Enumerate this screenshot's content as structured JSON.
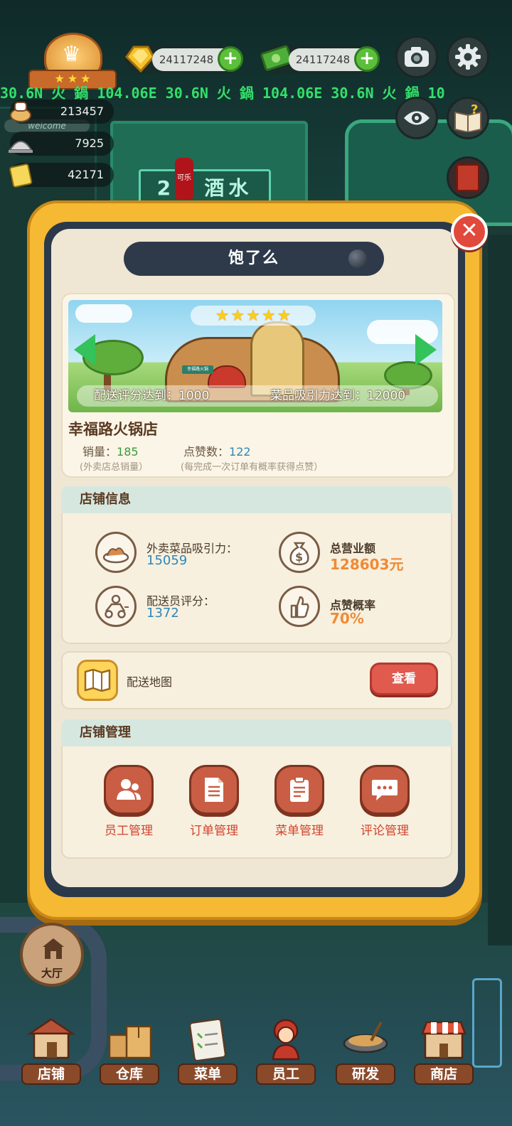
{
  "hud": {
    "currency_gold": "24117248",
    "currency_cash": "24117248",
    "ticker": "30.6N  火 鍋 104.06E 30.6N  火 鍋 104.06E 30.6N  火 鍋 10",
    "ticker_start": "30.6N",
    "stat_1": "213457",
    "stat_2": "7925",
    "stat_3": "42171",
    "welcome": "welcome"
  },
  "background": {
    "store_sign": "24 酒水",
    "cola": "可乐"
  },
  "modal": {
    "title": "饱了么",
    "close": "✕",
    "banner": {
      "stars": 5,
      "delivery_req": "配送评分达到：1000",
      "dish_req": "菜品吸引力达到：12000",
      "house_sign": "幸福路火锅"
    },
    "shop_name": "幸福路火锅店",
    "sales_label": "销量：",
    "sales_value": "185",
    "sales_note": "(外卖店总销量）",
    "likes_label": "点赞数：",
    "likes_value": "122",
    "likes_note": "(每完成一次订单有概率获得点赞）",
    "info_section": {
      "title": "店铺信息",
      "attract_label": "外卖菜品吸引力：",
      "attract_value": "15059",
      "revenue_label": "总营业额",
      "revenue_value": "128603元",
      "rider_label": "配送员评分：",
      "rider_value": "1372",
      "like_rate_label": "点赞概率",
      "like_rate_value": "70%"
    },
    "map": {
      "label": "配送地图",
      "button": "查看"
    },
    "manage_section": {
      "title": "店铺管理",
      "items": [
        "员工管理",
        "订单管理",
        "菜单管理",
        "评论管理"
      ]
    }
  },
  "nav": {
    "hall": "大厅",
    "items": [
      "店铺",
      "仓库",
      "菜单",
      "员工",
      "研发",
      "商店"
    ]
  },
  "colors": {
    "accent_red": "#e15a4e",
    "panel_gold": "#f5b934",
    "value_blue": "#2f86b6",
    "value_orange": "#f08a35",
    "manage_red": "#d2432e"
  }
}
